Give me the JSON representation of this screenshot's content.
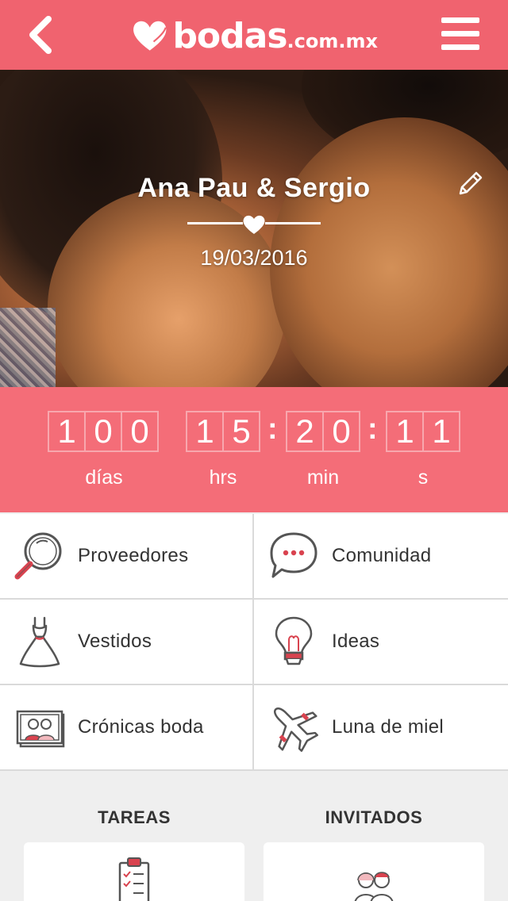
{
  "header": {
    "logo_main": "bodas",
    "logo_suffix": ".com.mx",
    "back_icon": "chevron-left-icon",
    "menu_icon": "hamburger-menu-icon"
  },
  "hero": {
    "couple_names": "Ana Pau & Sergio",
    "wedding_date": "19/03/2016",
    "edit_icon": "pencil-icon"
  },
  "countdown": {
    "days": [
      "1",
      "0",
      "0"
    ],
    "hours": [
      "1",
      "5"
    ],
    "minutes": [
      "2",
      "0"
    ],
    "seconds": [
      "1",
      "1"
    ],
    "labels": {
      "days": "días",
      "hours": "hrs",
      "minutes": "min",
      "seconds": "s"
    }
  },
  "menu": {
    "items": [
      {
        "label": "Proveedores",
        "icon": "magnifier-icon"
      },
      {
        "label": "Comunidad",
        "icon": "chat-bubble-icon"
      },
      {
        "label": "Vestidos",
        "icon": "dress-icon"
      },
      {
        "label": "Ideas",
        "icon": "lightbulb-icon"
      },
      {
        "label": "Crónicas boda",
        "icon": "photo-album-icon"
      },
      {
        "label": "Luna de miel",
        "icon": "airplane-icon"
      }
    ]
  },
  "bottom": {
    "tasks_title": "TAREAS",
    "guests_title": "INVITADOS"
  },
  "colors": {
    "brand": "#f0636f",
    "countdown_bg": "#f46d78",
    "accent_red": "#d9434f"
  }
}
